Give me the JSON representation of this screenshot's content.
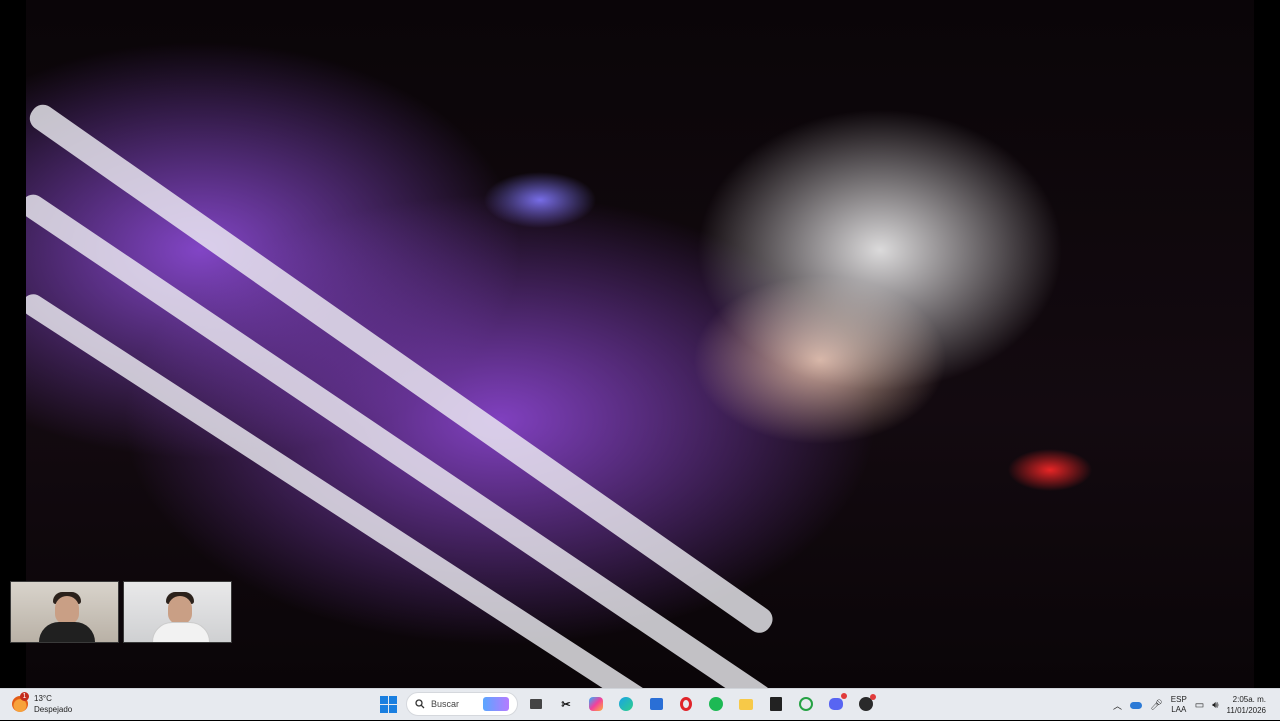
{
  "video": {
    "description_colors": {
      "purple": "#8c46d2",
      "red": "#ff2a2a",
      "white": "#f0f0f5"
    }
  },
  "call_thumbnails": [
    {
      "name": "participant-1"
    },
    {
      "name": "participant-2"
    }
  ],
  "taskbar": {
    "weather": {
      "temp": "13°C",
      "condition": "Despejado",
      "badge": "1"
    },
    "search_label": "Buscar",
    "apps": [
      {
        "icon": "start-icon"
      },
      {
        "icon": "search-icon"
      },
      {
        "icon": "game-thumbnail-icon"
      },
      {
        "icon": "task-view-icon"
      },
      {
        "icon": "capcut-icon"
      },
      {
        "icon": "copilot-icon"
      },
      {
        "icon": "edge-icon"
      },
      {
        "icon": "store-icon"
      },
      {
        "icon": "opera-icon"
      },
      {
        "icon": "spotify-icon"
      },
      {
        "icon": "file-explorer-icon"
      },
      {
        "icon": "epic-games-icon"
      },
      {
        "icon": "whatsapp-icon"
      },
      {
        "icon": "discord-icon"
      },
      {
        "icon": "brawl-icon"
      }
    ],
    "tray": {
      "lang_top": "ESP",
      "lang_bottom": "LAA",
      "time": "2:05a. m.",
      "date": "11/01/2026"
    }
  }
}
